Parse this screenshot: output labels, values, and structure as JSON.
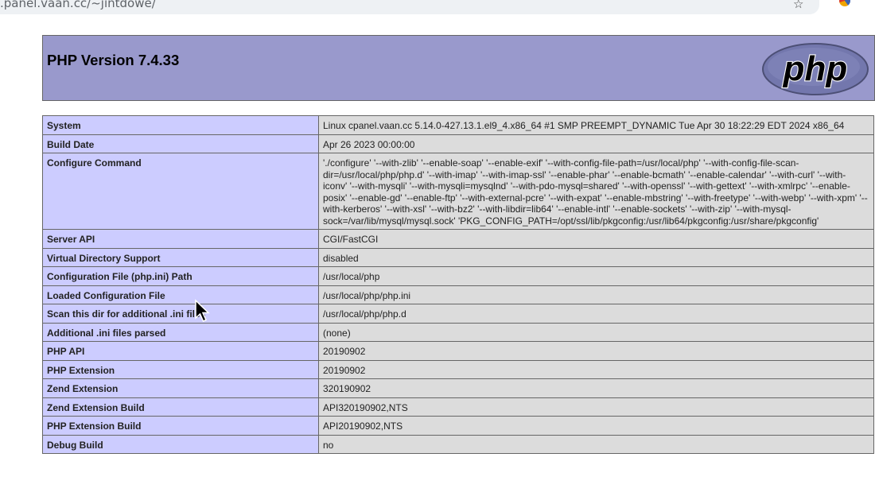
{
  "browser": {
    "url_text": ".panel.vaan.cc/~jintdowe/",
    "star_icon": "star-icon",
    "extension_icon": "extension-icon"
  },
  "header": {
    "title": "PHP Version 7.4.33",
    "logo_text": "php",
    "logo_color": "#7377ad",
    "background_color": "#9999cc"
  },
  "rows": [
    {
      "key": "System",
      "value": "Linux cpanel.vaan.cc 5.14.0-427.13.1.el9_4.x86_64 #1 SMP PREEMPT_DYNAMIC Tue Apr 30 18:22:29 EDT 2024 x86_64"
    },
    {
      "key": "Build Date",
      "value": "Apr 26 2023 00:00:00"
    },
    {
      "key": "Configure Command",
      "value": "'./configure' '--with-zlib' '--enable-soap' '--enable-exif' '--with-config-file-path=/usr/local/php' '--with-config-file-scan-dir=/usr/local/php/php.d' '--with-imap' '--with-imap-ssl' '--enable-phar' '--enable-bcmath' '--enable-calendar' '--with-curl' '--with-iconv' '--with-mysqli' '--with-mysqli=mysqlnd' '--with-pdo-mysql=shared' '--with-openssl' '--with-gettext' '--with-xmlrpc' '--enable-posix' '--enable-gd' '--enable-ftp' '--with-external-pcre' '--with-expat' '--enable-mbstring' '--with-freetype' '--with-webp' '--with-xpm' '--with-kerberos' '--with-xsl' '--with-bz2' '--with-libdir=lib64' '--enable-intl' '--enable-sockets' '--with-zip' '--with-mysql-sock=/var/lib/mysql/mysql.sock' 'PKG_CONFIG_PATH=/opt/ssl/lib/pkgconfig:/usr/lib64/pkgconfig:/usr/share/pkgconfig'"
    },
    {
      "key": "Server API",
      "value": "CGI/FastCGI"
    },
    {
      "key": "Virtual Directory Support",
      "value": "disabled"
    },
    {
      "key": "Configuration File (php.ini) Path",
      "value": "/usr/local/php"
    },
    {
      "key": "Loaded Configuration File",
      "value": "/usr/local/php/php.ini"
    },
    {
      "key": "Scan this dir for additional .ini files",
      "value": "/usr/local/php/php.d"
    },
    {
      "key": "Additional .ini files parsed",
      "value": "(none)"
    },
    {
      "key": "PHP API",
      "value": "20190902"
    },
    {
      "key": "PHP Extension",
      "value": "20190902"
    },
    {
      "key": "Zend Extension",
      "value": "320190902"
    },
    {
      "key": "Zend Extension Build",
      "value": "API320190902,NTS"
    },
    {
      "key": "PHP Extension Build",
      "value": "API20190902,NTS"
    },
    {
      "key": "Debug Build",
      "value": "no"
    }
  ]
}
